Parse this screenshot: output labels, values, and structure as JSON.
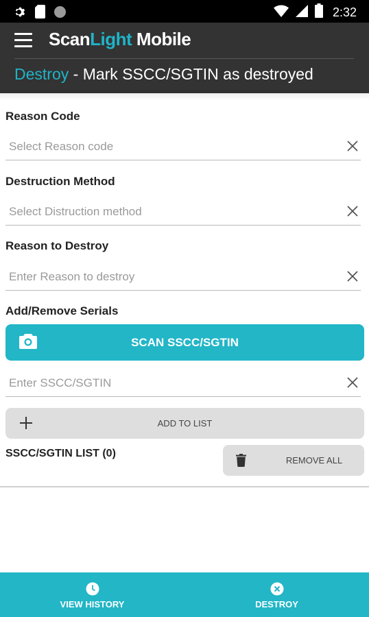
{
  "status_bar": {
    "time": "2:32"
  },
  "app": {
    "brand_prefix": "Scan",
    "brand_accent": "Light",
    "brand_suffix": " Mobile",
    "subtitle_accent": "Destroy",
    "subtitle_rest": " - Mark SSCC/SGTIN as destroyed"
  },
  "form": {
    "reason_code_label": "Reason Code",
    "reason_code_placeholder": "Select Reason code",
    "destruction_method_label": "Destruction Method",
    "destruction_method_placeholder": "Select Distruction method",
    "reason_destroy_label": "Reason to Destroy",
    "reason_destroy_placeholder": "Enter Reason to destroy",
    "serials_label": "Add/Remove Serials",
    "scan_button": "SCAN SSCC/SGTIN",
    "serial_placeholder": "Enter SSCC/SGTIN",
    "add_button": "ADD TO LIST",
    "list_label": "SSCC/SGTIN LIST (0)",
    "remove_all_button": "REMOVE ALL"
  },
  "bottom_nav": {
    "history_label": "VIEW HISTORY",
    "destroy_label": "DESTROY"
  },
  "colors": {
    "accent": "#1fb4c8",
    "appbar": "#333333",
    "button_gray": "#dedede"
  }
}
